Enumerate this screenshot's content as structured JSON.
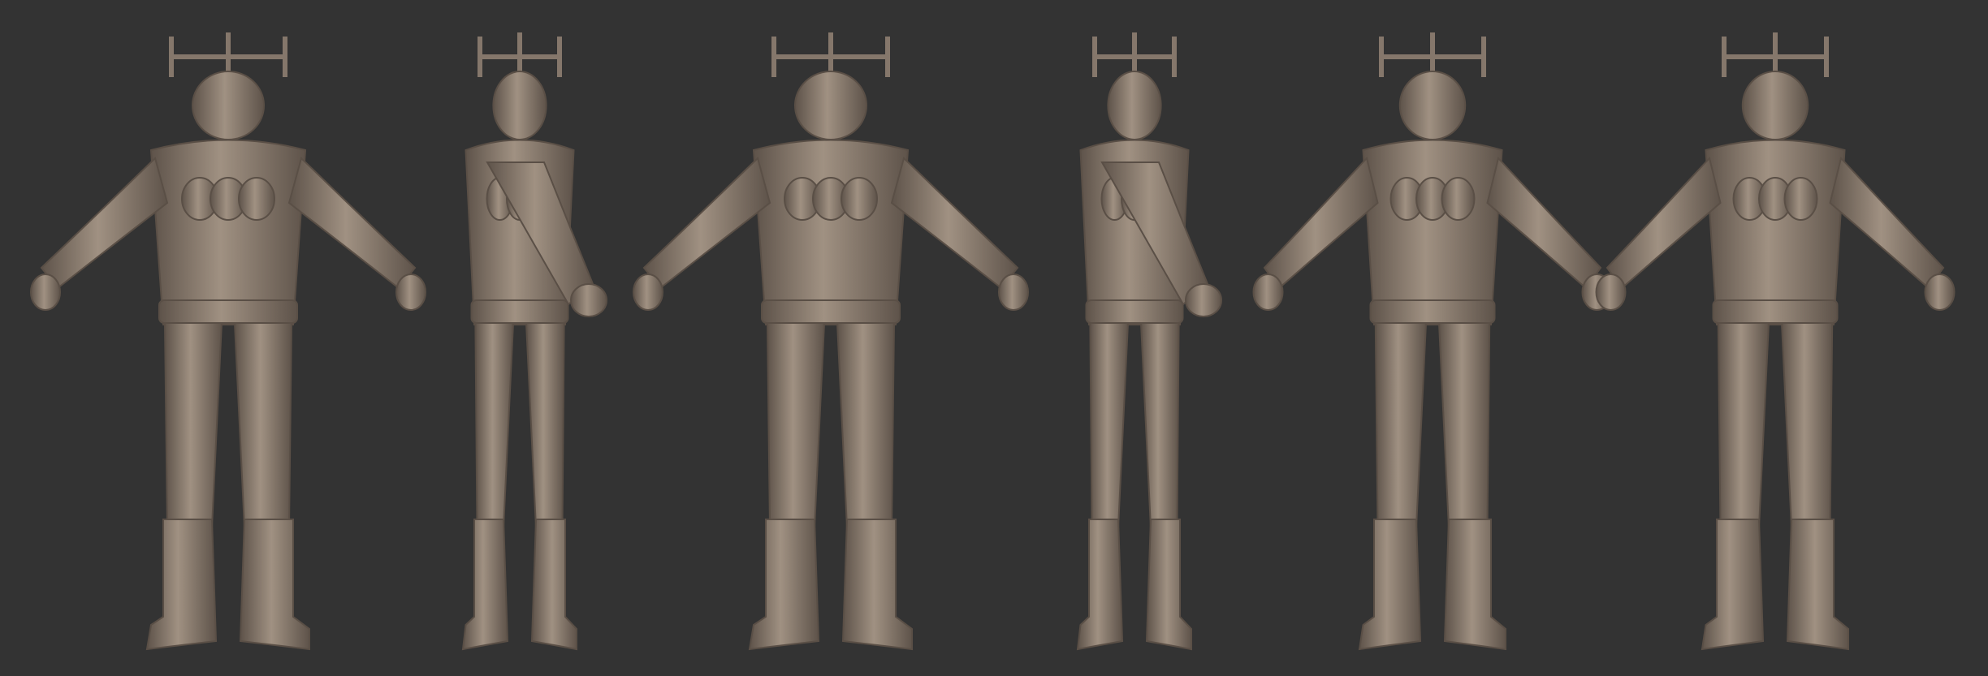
{
  "colors": {
    "background": "#333333",
    "sculpt": "#85776b",
    "sculpt_light": "#a39485",
    "sculpt_dark": "#5a4f46"
  }
}
